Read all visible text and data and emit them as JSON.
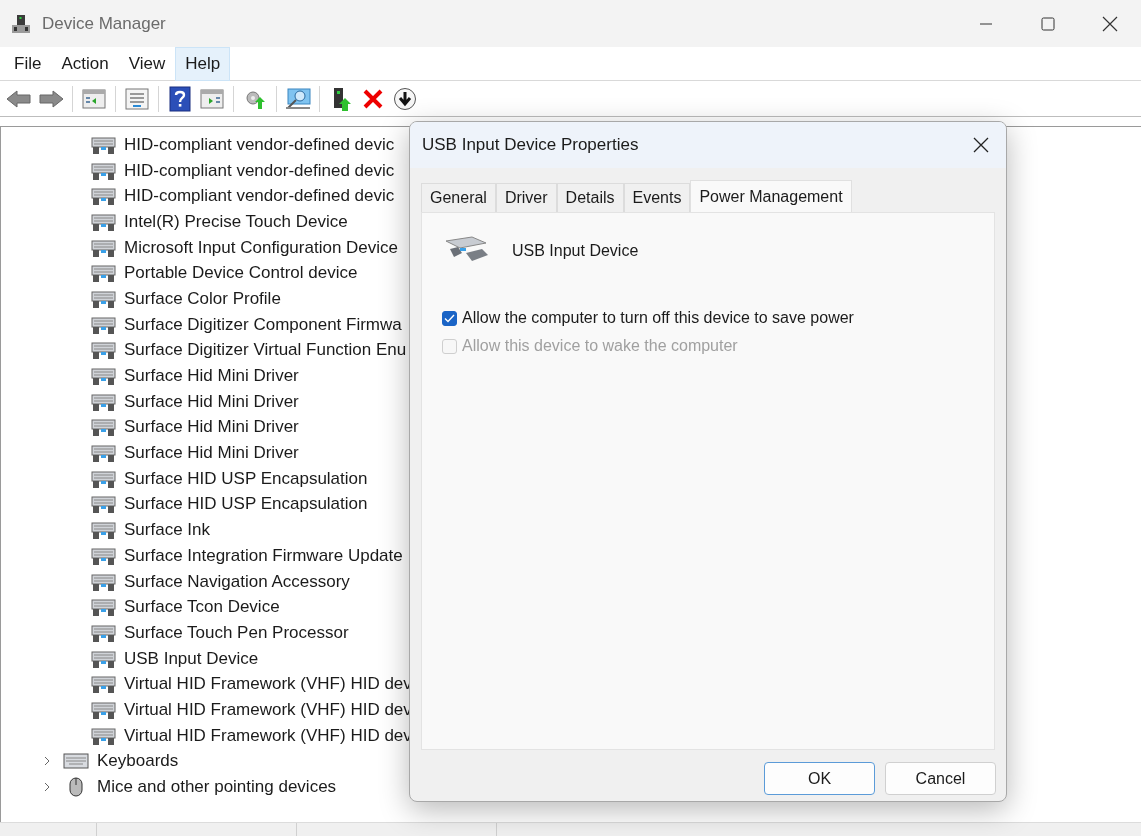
{
  "window": {
    "title": "Device Manager"
  },
  "menu": [
    {
      "label": "File",
      "selected": false
    },
    {
      "label": "Action",
      "selected": false
    },
    {
      "label": "View",
      "selected": false
    },
    {
      "label": "Help",
      "selected": true
    }
  ],
  "tree": {
    "devices": [
      "HID-compliant vendor-defined devic",
      "HID-compliant vendor-defined devic",
      "HID-compliant vendor-defined devic",
      "Intel(R) Precise Touch Device",
      "Microsoft Input Configuration Device",
      "Portable Device Control device",
      "Surface Color Profile",
      "Surface Digitizer Component Firmwa",
      "Surface Digitizer Virtual Function Enu",
      "Surface Hid Mini Driver",
      "Surface Hid Mini Driver",
      "Surface Hid Mini Driver",
      "Surface Hid Mini Driver",
      "Surface HID USP Encapsulation",
      "Surface HID USP Encapsulation",
      "Surface Ink",
      "Surface Integration Firmware Update",
      "Surface Navigation Accessory",
      "Surface Tcon Device",
      "Surface Touch Pen Processor",
      "USB Input Device",
      "Virtual HID Framework (VHF) HID dev",
      "Virtual HID Framework (VHF) HID dev",
      "Virtual HID Framework (VHF) HID dev"
    ],
    "categories": [
      {
        "label": "Keyboards",
        "kind": "keyboard",
        "expanded": false
      },
      {
        "label": "Mice and other pointing devices",
        "kind": "mouse",
        "expanded": false
      }
    ]
  },
  "dialog": {
    "title": "USB Input Device Properties",
    "tabs": [
      {
        "label": "General",
        "selected": false
      },
      {
        "label": "Driver",
        "selected": false
      },
      {
        "label": "Details",
        "selected": false
      },
      {
        "label": "Events",
        "selected": false
      },
      {
        "label": "Power Management",
        "selected": true
      }
    ],
    "device_name": "USB Input Device",
    "options": [
      {
        "label": "Allow the computer to turn off this device to save power",
        "checked": true,
        "disabled": false
      },
      {
        "label": "Allow this device to wake the computer",
        "checked": false,
        "disabled": true
      }
    ],
    "buttons": [
      {
        "label": "OK",
        "default": true
      },
      {
        "label": "Cancel",
        "default": false
      }
    ]
  }
}
